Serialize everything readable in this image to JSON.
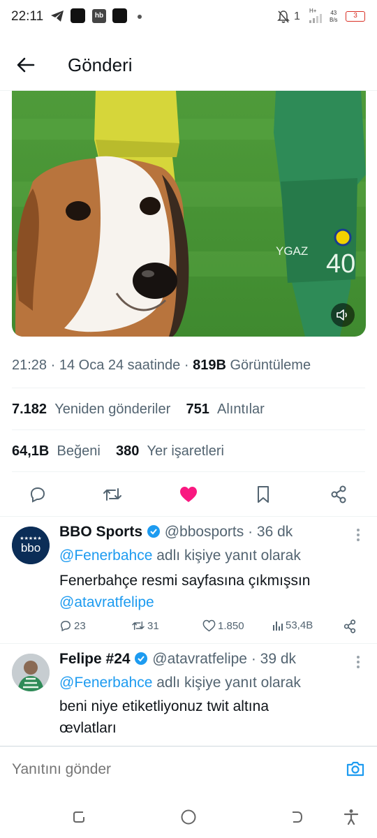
{
  "status_bar": {
    "time": "22:11",
    "hb_label": "hb",
    "net_type": "H+",
    "net_speed_value": "43",
    "net_speed_unit": "B/s",
    "battery_level": "3"
  },
  "header": {
    "title": "Gönderi"
  },
  "tweet": {
    "time": "21:28",
    "date_text": "14 Oca 24 saatinde",
    "views_count": "819B",
    "views_label": "Görüntüleme",
    "reposts_count": "7.182",
    "reposts_label": "Yeniden gönderiler",
    "quotes_count": "751",
    "quotes_label": "Alıntılar",
    "likes_count": "64,1B",
    "likes_label": "Beğeni",
    "bookmarks_count": "380",
    "bookmarks_label": "Yer işaretleri",
    "media_jersey_number": "40",
    "media_jersey_text": "YGAZ"
  },
  "replies": [
    {
      "name": "BBO Sports",
      "handle": "@bbosports",
      "time": "36 dk",
      "avatar_text": "bbo",
      "reply_to_handle": "@Fenerbahce",
      "reply_to_suffix": "adlı kişiye yanıt olarak",
      "text_line1": "Fenerbahçe resmi sayfasına çıkmışsın",
      "text_mention": "@atavratfelipe",
      "comments": "23",
      "reposts": "31",
      "likes": "1.850",
      "views": "53,4B"
    },
    {
      "name": "Felipe #24",
      "handle": "@atavratfelipe",
      "time": "39 dk",
      "reply_to_handle": "@Fenerbahce",
      "reply_to_suffix": "adlı kişiye yanıt olarak",
      "text_line1": "beni niye etiketliyonuz twit altına",
      "text_line2": "œvlatları"
    }
  ],
  "compose": {
    "placeholder": "Yanıtını gönder"
  },
  "colors": {
    "accent": "#1d9bf0",
    "like": "#f91880",
    "verified": "#1d9bf0",
    "muted": "#536471"
  }
}
